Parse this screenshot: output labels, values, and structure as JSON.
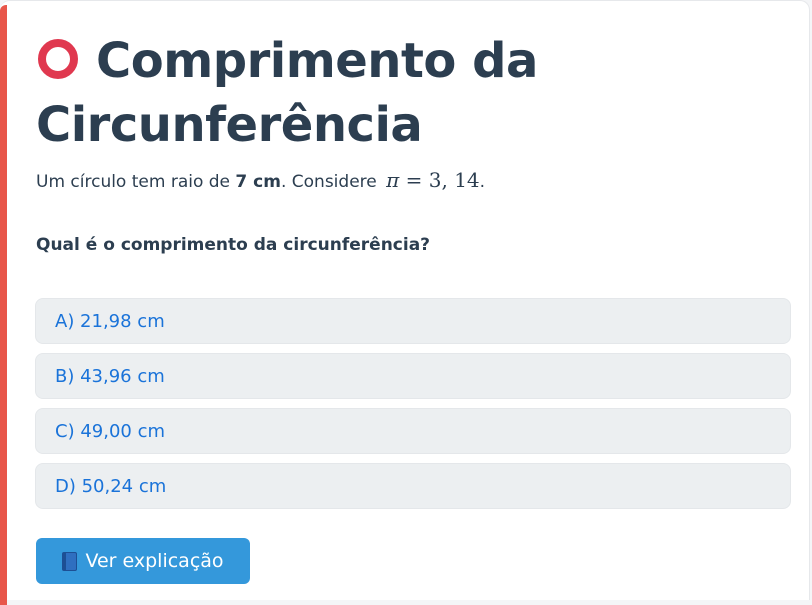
{
  "title": {
    "text": "Comprimento da Circunferência",
    "icon": "hollow-red-circle-icon"
  },
  "statement": {
    "prefix": "Um círculo tem raio de ",
    "radius": "7 cm",
    "middle": ". Considere ",
    "math_symbol": "π",
    "math_rest": " = 3, 14",
    "suffix": "."
  },
  "question": "Qual é o comprimento da circunferência?",
  "options": [
    "A) 21,98 cm",
    "B) 43,96 cm",
    "C) 49,00 cm",
    "D) 50,24 cm"
  ],
  "explain_button": {
    "label": "Ver explicação",
    "icon": "book-icon"
  },
  "colors": {
    "accent": "#e8564a",
    "title": "#2c3e50",
    "option_text": "#1a73d9",
    "button": "#3498db"
  }
}
